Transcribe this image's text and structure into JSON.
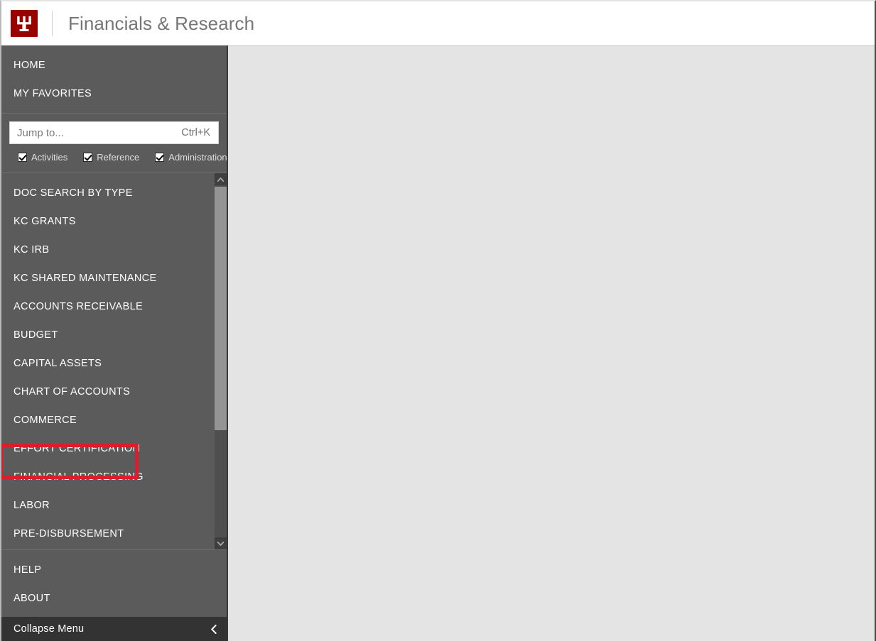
{
  "header": {
    "logo_icon": "iu-trident-logo",
    "title": "Financials & Research"
  },
  "sidebar": {
    "top_items": [
      {
        "label": "HOME",
        "name": "home"
      },
      {
        "label": "MY FAVORITES",
        "name": "my-favorites"
      }
    ],
    "search": {
      "placeholder": "Jump to...",
      "value": "",
      "shortcut": "Ctrl+K"
    },
    "filters": [
      {
        "label": "Activities",
        "checked": true
      },
      {
        "label": "Reference",
        "checked": true
      },
      {
        "label": "Administration",
        "checked": true
      }
    ],
    "menu_items": [
      {
        "label": "DOC SEARCH BY TYPE",
        "name": "doc-search-by-type",
        "highlighted": false
      },
      {
        "label": "KC GRANTS",
        "name": "kc-grants",
        "highlighted": false
      },
      {
        "label": "KC IRB",
        "name": "kc-irb",
        "highlighted": false
      },
      {
        "label": "KC SHARED MAINTENANCE",
        "name": "kc-shared-maintenance",
        "highlighted": false
      },
      {
        "label": "ACCOUNTS RECEIVABLE",
        "name": "accounts-receivable",
        "highlighted": false
      },
      {
        "label": "BUDGET",
        "name": "budget",
        "highlighted": false
      },
      {
        "label": "CAPITAL ASSETS",
        "name": "capital-assets",
        "highlighted": false
      },
      {
        "label": "CHART OF ACCOUNTS",
        "name": "chart-of-accounts",
        "highlighted": false
      },
      {
        "label": "COMMERCE",
        "name": "commerce",
        "highlighted": false
      },
      {
        "label": "EFFORT CERTIFICATION",
        "name": "effort-certification",
        "highlighted": false
      },
      {
        "label": "FINANCIAL PROCESSING",
        "name": "financial-processing",
        "highlighted": true
      },
      {
        "label": "LABOR",
        "name": "labor",
        "highlighted": false
      },
      {
        "label": "PRE-DISBURSEMENT",
        "name": "pre-disbursement",
        "highlighted": false
      }
    ],
    "bottom_items": [
      {
        "label": "HELP",
        "name": "help"
      },
      {
        "label": "ABOUT",
        "name": "about"
      }
    ],
    "collapse": {
      "label": "Collapse Menu",
      "icon": "chevron-left-icon"
    },
    "scrollbar": {
      "up_icon": "chevron-up-icon",
      "down_icon": "chevron-down-icon"
    }
  },
  "colors": {
    "brand_crimson": "#990000",
    "highlight_red": "#d91f2d",
    "sidebar_bg": "#5b5b5b",
    "collapse_bar_bg": "#333333",
    "content_bg": "#e4e4e4",
    "scroll_thumb": "#949494"
  },
  "main": {
    "content": ""
  }
}
